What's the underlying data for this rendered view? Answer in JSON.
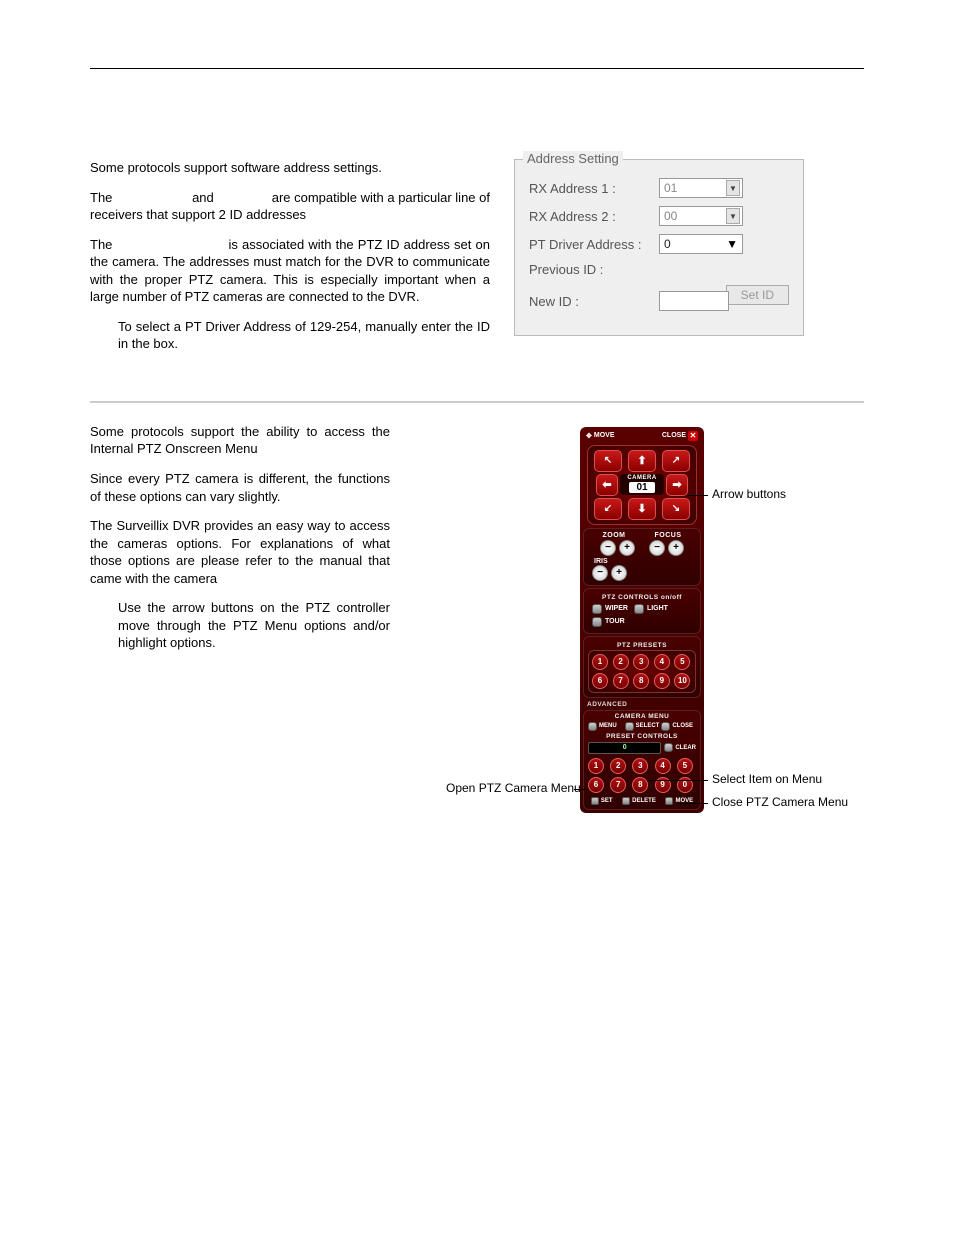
{
  "section1": {
    "p1": "Some protocols support software address settings.",
    "p2a": "The ",
    "p2b": " and ",
    "p2c": " are compatible with a particular line of receivers that support 2 ID addresses",
    "p3a": "The ",
    "p3b": " is associated with the PTZ ID address set on the camera.  The addresses must match for the DVR to communicate with the proper PTZ camera.  This is especially important when a large number of PTZ cameras are connected to the DVR.",
    "p4": "To select a PT Driver Address of 129-254, manually enter the ID in the box."
  },
  "addr": {
    "legend": "Address Setting",
    "rx1_label": "RX Address 1 :",
    "rx1_val": "01",
    "rx2_label": "RX Address 2 :",
    "rx2_val": "00",
    "ptd_label": "PT Driver Address  :",
    "ptd_val": "0",
    "prev_label": "Previous ID :",
    "new_label": "New ID :",
    "setid": "Set ID"
  },
  "section2": {
    "p1": "Some protocols support the ability to access the Internal PTZ Onscreen Menu",
    "p2": "Since every PTZ camera is different, the functions of these options can vary slightly.",
    "p3": "The Surveillix DVR provides an easy way to access the cameras options. For explanations of what those options are please refer to the manual that came with the camera",
    "p4": "Use the arrow buttons on the PTZ controller move through the PTZ Menu options and/or highlight options."
  },
  "ptz": {
    "move": "MOVE",
    "close": "CLOSE",
    "camera": "CAMERA",
    "cam_num": "01",
    "zoom": "ZOOM",
    "focus": "FOCUS",
    "iris": "IRIS",
    "controls_head": "PTZ CONTROLS   on/off",
    "wiper": "WIPER",
    "light": "LIGHT",
    "tour": "TOUR",
    "presets_head": "PTZ PRESETS",
    "presets": [
      "1",
      "2",
      "3",
      "4",
      "5",
      "6",
      "7",
      "8",
      "9",
      "10"
    ],
    "advanced": "ADVANCED",
    "camera_menu_head": "CAMERA MENU",
    "menu": "MENU",
    "select": "SELECT",
    "closebtn": "CLOSE",
    "preset_controls_head": "PRESET CONTROLS",
    "pc_val": "0",
    "clear": "CLEAR",
    "presets2": [
      "1",
      "2",
      "3",
      "4",
      "5",
      "6",
      "7",
      "8",
      "9",
      "0"
    ],
    "set": "SET",
    "delete": "DELETE",
    "moveb": "MOVE"
  },
  "callouts": {
    "arrow": "Arrow buttons",
    "open": "Open PTZ Camera Menu",
    "select": "Select Item on Menu",
    "close": "Close PTZ Camera Menu"
  }
}
